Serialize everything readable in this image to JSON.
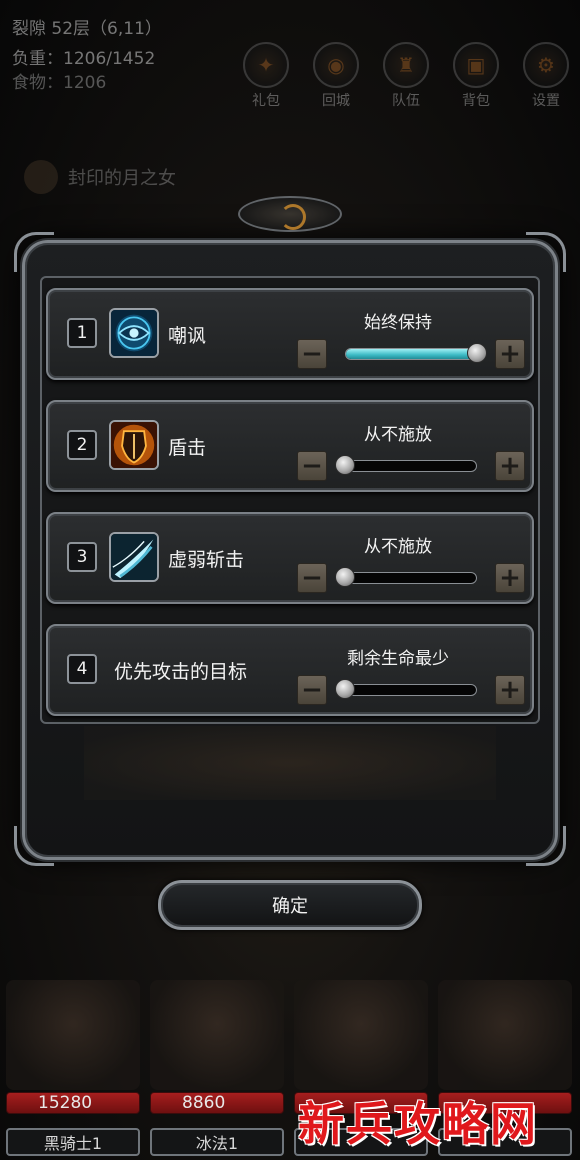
{
  "status": {
    "location": "裂隙 52层（6,11）",
    "load": "负重：1206/1452",
    "food": "食物：1206"
  },
  "top_nav": [
    {
      "label": "礼包",
      "icon": "gift-icon"
    },
    {
      "label": "回城",
      "icon": "return-city-icon"
    },
    {
      "label": "队伍",
      "icon": "team-icon"
    },
    {
      "label": "背包",
      "icon": "backpack-icon"
    },
    {
      "label": "设置",
      "icon": "settings-icon"
    }
  ],
  "background_hero": "封印的月之女",
  "skills": [
    {
      "index": "1",
      "name": "嘲讽",
      "setting": "始终保持",
      "level": 1.0,
      "icon": "taunt-eye-icon",
      "accent": "#2aa6d8"
    },
    {
      "index": "2",
      "name": "盾击",
      "setting": "从不施放",
      "level": 0.0,
      "icon": "shield-bash-icon",
      "accent": "#e08a14"
    },
    {
      "index": "3",
      "name": "虚弱斩击",
      "setting": "从不施放",
      "level": 0.0,
      "icon": "weakening-slash-icon",
      "accent": "#7fd6e8"
    },
    {
      "index": "4",
      "name": "优先攻击的目标",
      "setting": "剩余生命最少",
      "level": 0.0,
      "icon": "",
      "accent": ""
    }
  ],
  "buttons": {
    "minus": "−",
    "plus": "+",
    "confirm": "确定"
  },
  "party": [
    {
      "name": "黑骑士1",
      "hp": "15280"
    },
    {
      "name": "冰法1",
      "hp": "8860"
    },
    {
      "name": "",
      "hp": ""
    },
    {
      "name": "",
      "hp": ""
    }
  ],
  "watermark": "新兵攻略网",
  "colors": {
    "slider_fill": "#3bb9c4",
    "hp_bar": "#a61e1e",
    "watermark": "#e0181c"
  }
}
